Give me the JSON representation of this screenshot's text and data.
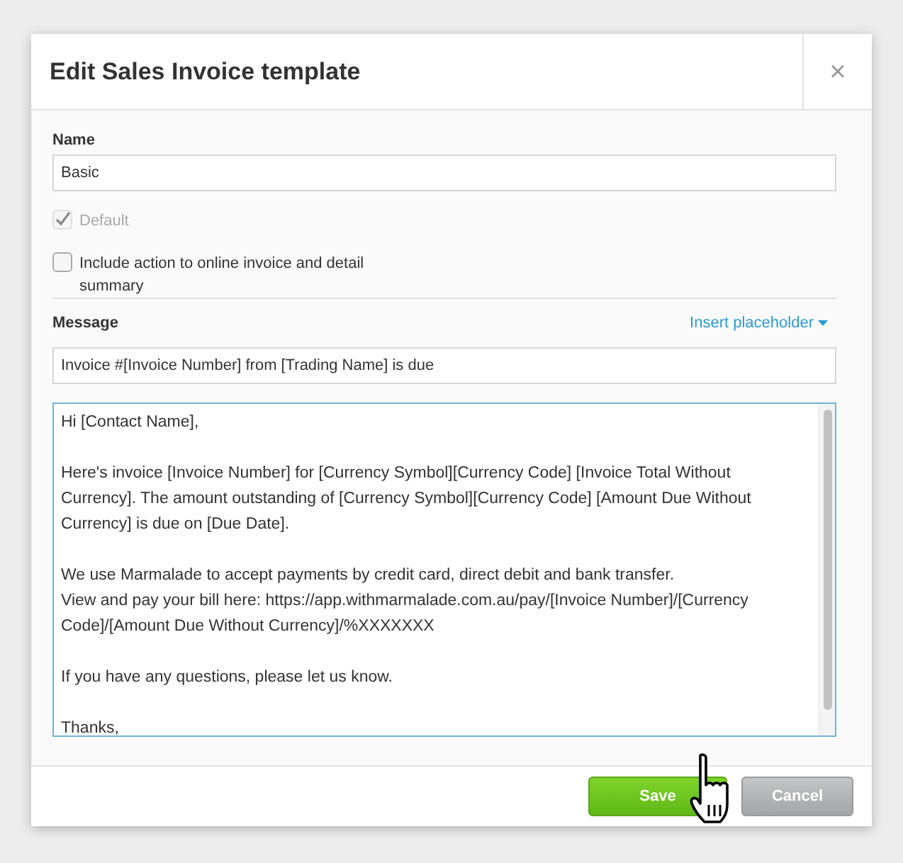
{
  "dialog": {
    "title": "Edit Sales Invoice template",
    "close": "×"
  },
  "name_field": {
    "label": "Name",
    "value": "Basic"
  },
  "checkboxes": [
    {
      "label": "Default",
      "checked": true,
      "disabled": true
    },
    {
      "label": "Include action to online invoice and detail summary",
      "checked": false,
      "disabled": false
    }
  ],
  "message": {
    "label": "Message",
    "insert_link": "Insert placeholder",
    "subject": "Invoice #[Invoice Number] from [Trading Name] is due",
    "body": "Hi [Contact Name],\n\nHere's invoice [Invoice Number] for [Currency Symbol][Currency Code] [Invoice Total Without Currency]. The amount outstanding of [Currency Symbol][Currency Code] [Amount Due Without Currency] is due on [Due Date].\n\nWe use Marmalade to accept payments by credit card, direct debit and bank transfer.\nView and pay your bill here: https://app.withmarmalade.com.au/pay/[Invoice Number]/[Currency Code]/[Amount Due Without Currency]/%XXXXXXX\n\nIf you have any questions, please let us know.\n\nThanks,"
  },
  "buttons": [
    {
      "label": "Save",
      "kind": "primary"
    },
    {
      "label": "Cancel",
      "kind": "secondary"
    }
  ]
}
